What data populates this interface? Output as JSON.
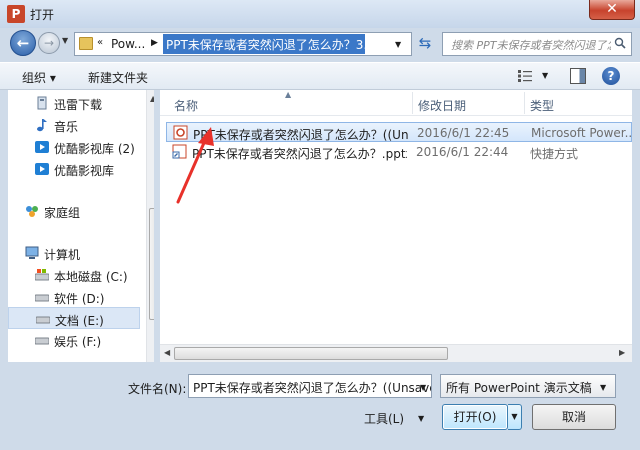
{
  "window": {
    "title": "打开",
    "app_icon": "P"
  },
  "address": {
    "crumb": "Pow...",
    "current": "PPT未保存或者突然闪退了怎么办？3..."
  },
  "search": {
    "placeholder": "搜索 PPT未保存或者突然闪退了怎么办？"
  },
  "toolbar": {
    "organize": "组织 ▾",
    "new_folder": "新建文件夹"
  },
  "nav": [
    {
      "label": "迅雷下载",
      "icon": "download-icon"
    },
    {
      "label": "音乐",
      "icon": "music-icon"
    },
    {
      "label": "优酷影视库 (2)",
      "icon": "video-icon"
    },
    {
      "label": "优酷影视库",
      "icon": "video-icon"
    },
    {
      "label": "家庭组",
      "icon": "homegroup-icon"
    },
    {
      "label": "计算机",
      "icon": "computer-icon"
    },
    {
      "label": "本地磁盘 (C:)",
      "icon": "drive-icon"
    },
    {
      "label": "软件 (D:)",
      "icon": "drive-icon"
    },
    {
      "label": "文档 (E:)",
      "icon": "drive-icon"
    },
    {
      "label": "娱乐 (F:)",
      "icon": "drive-icon"
    }
  ],
  "columns": {
    "name": "名称",
    "date": "修改日期",
    "type": "类型"
  },
  "files": [
    {
      "name": "PPT未保存或者突然闪退了怎么办？((Un...",
      "date": "2016/6/1 22:45",
      "type": "Microsoft Power...",
      "icon": "pptx-file-icon"
    },
    {
      "name": "PPT未保存或者突然闪退了怎么办？.pptx",
      "date": "2016/6/1 22:44",
      "type": "快捷方式",
      "icon": "shortcut-icon"
    }
  ],
  "bottom": {
    "filename_label": "文件名(N):",
    "filename_value": "PPT未保存或者突然闪退了怎么办？((Unsave",
    "filetype": "所有 PowerPoint 演示文稿",
    "tools": "工具(L)",
    "open": "打开(O)",
    "cancel": "取消"
  },
  "colors": {
    "accent": "#3b78c8",
    "annotation_arrow": "#e8312a"
  }
}
